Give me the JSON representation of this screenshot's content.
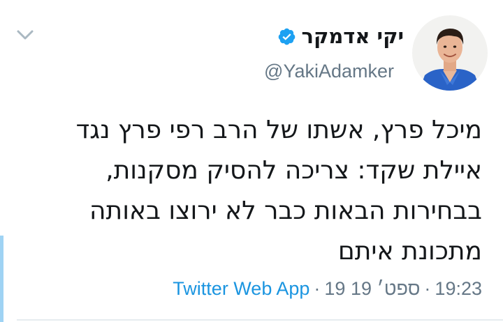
{
  "author": {
    "display_name": "יקי אדמקר",
    "handle": "@YakiAdamker",
    "verified": true
  },
  "tweet": {
    "lines": [
      "מיכל פרץ, אשתו של הרב רפי פרץ נגד",
      "איילת שקד: צריכה להסיק מסקנות,",
      "בבחירות הבאות כבר לא ירוצו באותה",
      "מתכונת איתם"
    ]
  },
  "meta": {
    "time": "19:23",
    "date": "19 ספט׳ 19",
    "separator": "·",
    "source": "Twitter Web App"
  },
  "colors": {
    "text": "#14171a",
    "secondary": "#657786",
    "link": "#1b95e0",
    "verified_badge": "#1da1f2",
    "accent_bar": "#9fd3f4"
  },
  "icons": {
    "chevron": "chevron-down-icon",
    "verified": "verified-badge-icon"
  }
}
